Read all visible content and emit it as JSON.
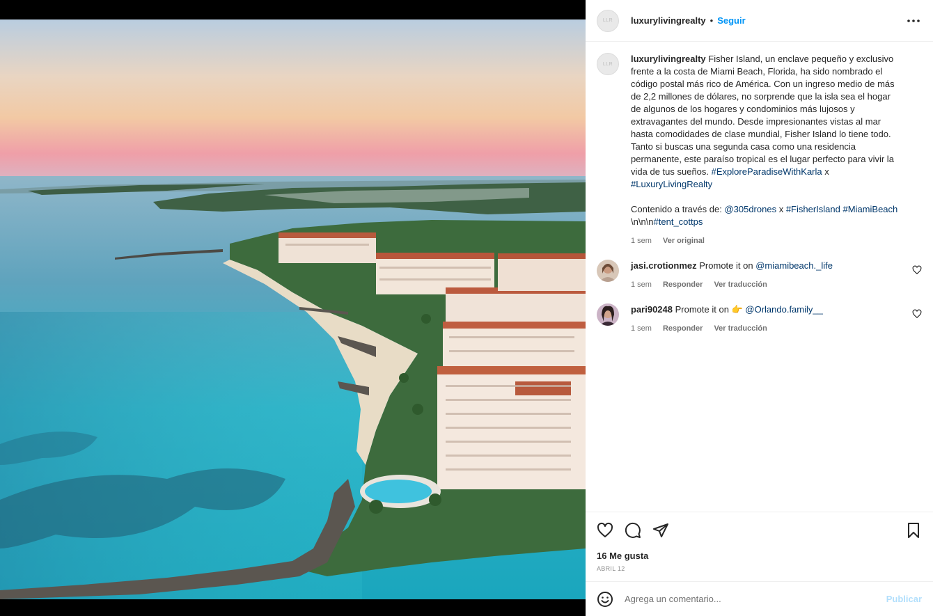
{
  "post": {
    "username": "luxurylivingrealty",
    "separator": "•",
    "follow_label": "Seguir",
    "more_icon": "more-horizontal-icon"
  },
  "caption": {
    "username": "luxurylivingrealty",
    "text": "Fisher Island, un enclave pequeño y exclusivo frente a la costa de Miami Beach, Florida, ha sido nombrado el código postal más rico de América. Con un ingreso medio de más de 2,2 millones de dólares, no sorprende que la isla sea el hogar de algunos de los hogares y condominios más lujosos y extravagantes del mundo. Desde impresionantes vistas al mar hasta comodidades de clase mundial, Fisher Island lo tiene todo. Tanto si buscas una segunda casa como una residencia permanente, este paraíso tropical es el lugar perfecto para vivir la vida de tus sueños.",
    "tag1": "#ExploreParadiseWithKarla",
    "x1": "x",
    "tag2": "#LuxuryLivingRealty",
    "credit_prefix": "Contenido a través de:",
    "mention1": "@305drones",
    "x2": "x",
    "tag3": "#FisherIsland",
    "tag4": "#MiamiBeach",
    "literal": "\\n\\n\\n",
    "tag5": "#tent_cottps",
    "time": "1 sem",
    "see_original": "Ver original"
  },
  "comments": [
    {
      "username": "jasi.crotionmez",
      "text": "Promote it on",
      "emoji": "",
      "mention": "@miamibeach._life",
      "time": "1 sem",
      "reply": "Responder",
      "translate": "Ver traducción"
    },
    {
      "username": "pari90248",
      "text": "Promote it on",
      "emoji": "👉",
      "mention": "@Orlando.family__",
      "time": "1 sem",
      "reply": "Responder",
      "translate": "Ver traducción"
    }
  ],
  "actions": {
    "likes": "16 Me gusta",
    "date": "ABRIL 12",
    "icons": [
      "heart-icon",
      "comment-icon",
      "share-icon",
      "bookmark-icon"
    ]
  },
  "add_comment": {
    "placeholder": "Agrega un comentario...",
    "publish_label": "Publicar",
    "emoji_icon": "smiley-icon"
  },
  "colors": {
    "link": "#00376b",
    "follow": "#0095f6",
    "publish_disabled": "#b2dffc"
  }
}
